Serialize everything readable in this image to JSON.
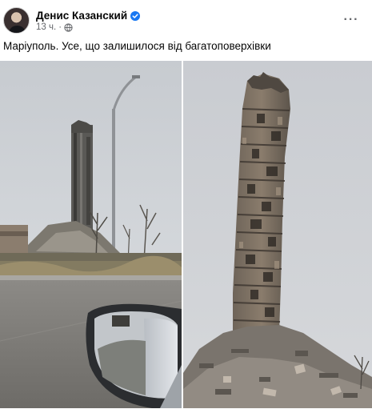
{
  "post": {
    "author": "Денис Казанский",
    "time": "13 ч.",
    "separator": "·",
    "text": "Маріуполь. Усе, що залишилося від багатоповерхівки",
    "more_label": "···"
  },
  "icons": {
    "verified": "verified-badge-icon",
    "audience": "globe-icon",
    "more": "more-options-icon"
  },
  "colors": {
    "verified_blue": "#1877f2",
    "secondary_text": "#65676b"
  }
}
